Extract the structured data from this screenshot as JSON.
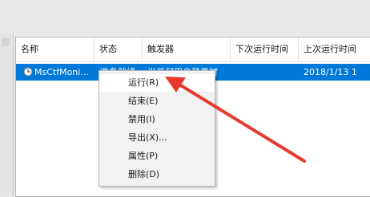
{
  "columns": [
    "名称",
    "状态",
    "触发器",
    "下次运行时间",
    "上次运行时间"
  ],
  "task": {
    "name": "MsCtfMoni...",
    "status": "准备就绪",
    "trigger": "当任何用户登录时",
    "next_run": "",
    "last_run": "2018/1/13 1"
  },
  "context_menu": {
    "items": [
      "运行(R)",
      "结束(E)",
      "禁用(I)",
      "导出(X)...",
      "属性(P)",
      "删除(D)"
    ],
    "highlighted_index": 0
  },
  "colors": {
    "selection": "#0078d7",
    "annotation_arrow": "#e8392e"
  },
  "icons": {
    "task": "clock-icon",
    "annotation": "red-arrow-icon"
  }
}
